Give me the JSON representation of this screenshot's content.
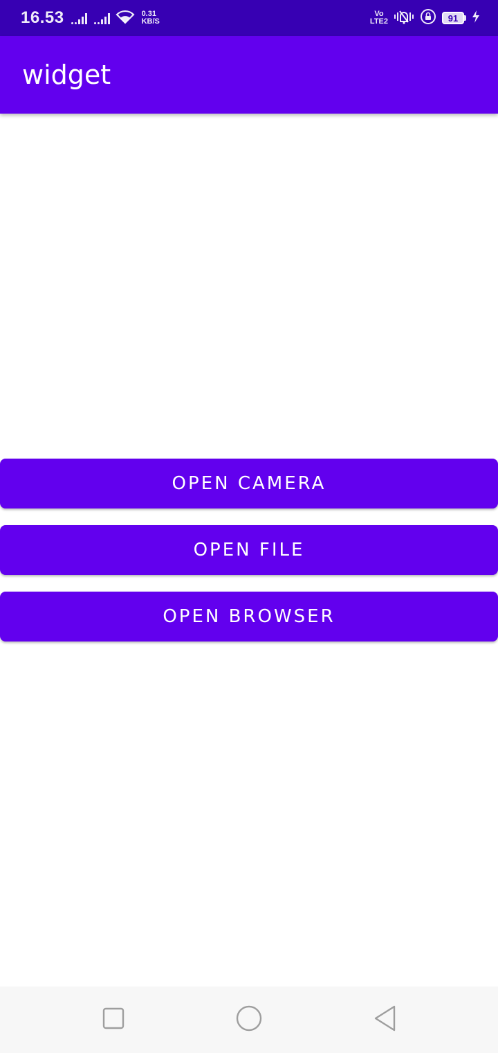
{
  "status_bar": {
    "time": "16.53",
    "net_speed_value": "0.31",
    "net_speed_unit": "KB/S",
    "volte_top": "Vo",
    "volte_bottom": "LTE2",
    "battery_level": "91"
  },
  "app_bar": {
    "title": "widget"
  },
  "buttons": {
    "open_camera": "OPEN CAMERA",
    "open_file": "OPEN FILE",
    "open_browser": "OPEN BROWSER"
  },
  "icons": {
    "recents": "recents-icon",
    "home": "home-icon",
    "back": "back-icon",
    "wifi": "wifi-icon",
    "vibrate": "vibrate-icon",
    "rotation_lock": "rotation-lock-icon",
    "charging": "charging-icon"
  },
  "colors": {
    "primary": "#6200ee",
    "primary_dark": "#3700b3",
    "nav_background": "#f7f7f7"
  }
}
